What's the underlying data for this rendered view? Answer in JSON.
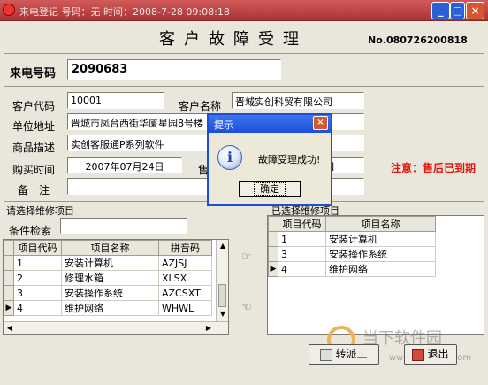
{
  "window": {
    "title": "来电登记  号码：无  时间：2008-7-28 09:08:18"
  },
  "form": {
    "title": "客户故障受理",
    "serial": "No.080726200818",
    "caller_label": "来电号码",
    "caller_value": "2090683",
    "fields": [
      {
        "label": "客户代码",
        "value": "10001"
      },
      {
        "label": "客户名称",
        "value": "晋城实创科贸有限公司"
      },
      {
        "label": "单位地址",
        "value": "晋城市凤台西街华厦星园8号楼"
      },
      {
        "label": "商品描述",
        "value": "实创客服通P系列软件"
      },
      {
        "label": "购买时间",
        "value": "2007年07月24日"
      },
      {
        "label": "售",
        "value": ""
      },
      {
        "label": "备　注",
        "value": ""
      }
    ],
    "second_date_value": "24日",
    "warning": "注意：售后已到期"
  },
  "left_panel": {
    "title": "请选择维修项目",
    "search_label": "条件检索",
    "search_value": "",
    "columns": [
      "项目代码",
      "项目名称",
      "拼音码"
    ],
    "rows": [
      {
        "code": "1",
        "name": "安装计算机",
        "py": "AZJSJ"
      },
      {
        "code": "2",
        "name": "修理水箱",
        "py": "XLSX"
      },
      {
        "code": "3",
        "name": "安装操作系统",
        "py": "AZCSXT"
      },
      {
        "code": "4",
        "name": "维护网络",
        "py": "WHWL"
      }
    ],
    "current_row": 4
  },
  "right_panel": {
    "title": "已选择维修项目",
    "columns": [
      "项目代码",
      "项目名称"
    ],
    "rows": [
      {
        "code": "1",
        "name": "安装计算机"
      },
      {
        "code": "3",
        "name": "安装操作系统"
      },
      {
        "code": "4",
        "name": "维护网络"
      }
    ],
    "current_row": 4
  },
  "buttons": {
    "transfer": "转派工",
    "exit": "退出"
  },
  "dialog": {
    "title": "提示",
    "message": "故障受理成功!",
    "ok": "确定"
  },
  "watermark": {
    "brand": "当下软件园",
    "url": "www.downxia.com"
  },
  "colors": {
    "warning": "#e0160d",
    "titlebar": "#b84040",
    "dialog_titlebar": "#1b4fd8"
  }
}
